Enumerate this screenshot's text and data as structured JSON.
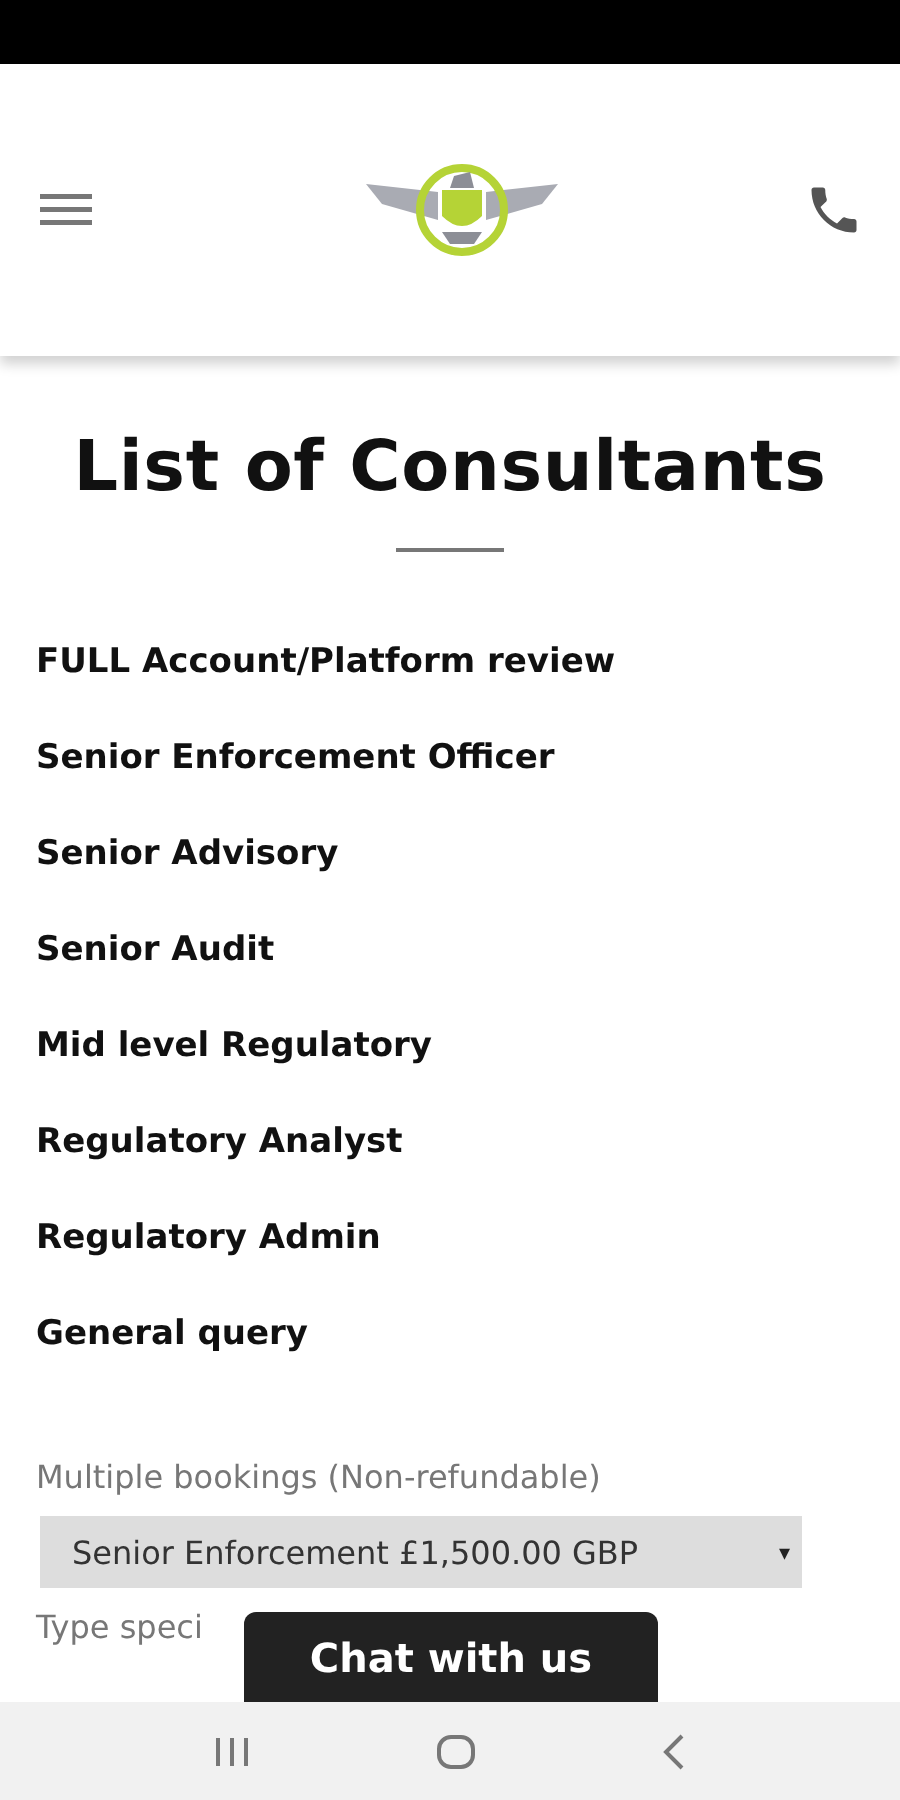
{
  "title": "List of Consultants",
  "services": [
    {
      "label": "FULL Account/Platform review"
    },
    {
      "label": "Senior Enforcement Officer"
    },
    {
      "label": "Senior Advisory"
    },
    {
      "label": "Senior Audit"
    },
    {
      "label": "Mid level Regulatory"
    },
    {
      "label": "Regulatory Analyst"
    },
    {
      "label": "Regulatory Admin"
    },
    {
      "label": "General query"
    }
  ],
  "booking": {
    "label": "Multiple bookings (Non-refundable)",
    "value": "Senior Enforcement £1,500.00 GBP",
    "caret": "▾"
  },
  "special_label": "Type speci",
  "chat_button": "Chat with us"
}
